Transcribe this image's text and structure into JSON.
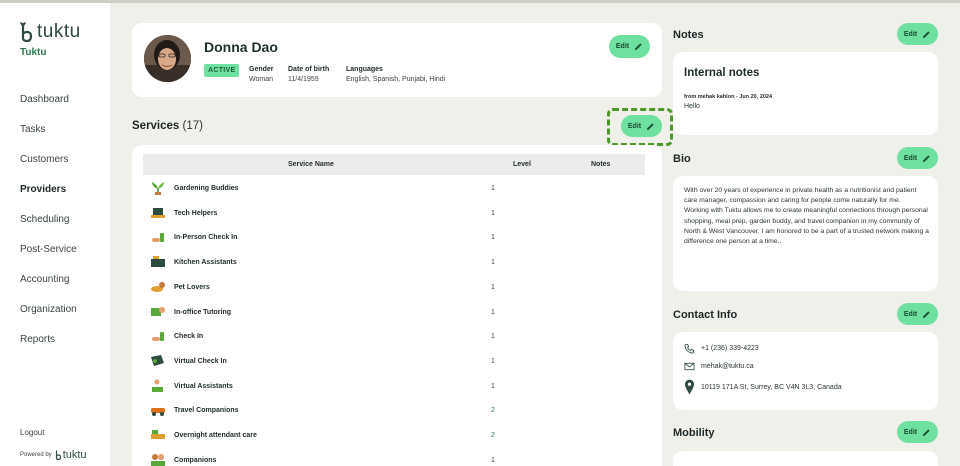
{
  "app": {
    "brand": "tuktu",
    "org_name": "Tuktu",
    "powered_by": "Powered by",
    "powered_brand": "tuktu"
  },
  "sidebar": {
    "items": [
      {
        "label": "Dashboard",
        "active": false
      },
      {
        "label": "Tasks",
        "active": false
      },
      {
        "label": "Customers",
        "active": false
      },
      {
        "label": "Providers",
        "active": true
      },
      {
        "label": "Scheduling",
        "active": false
      },
      {
        "label": "Post-Service",
        "active": false
      },
      {
        "label": "Accounting",
        "active": false
      },
      {
        "label": "Organization",
        "active": false
      },
      {
        "label": "Reports",
        "active": false
      }
    ],
    "logout": "Logout"
  },
  "profile": {
    "name": "Donna Dao",
    "status": "ACTIVE",
    "gender_label": "Gender",
    "gender": "Woman",
    "dob_label": "Date of birth",
    "dob": "11/4/1959",
    "languages_label": "Languages",
    "languages": "English, Spanish, Punjabi, Hindi",
    "edit_label": "Edit"
  },
  "services": {
    "title": "Services",
    "count": "(17)",
    "edit_label": "Edit",
    "columns": [
      "Service Name",
      "Level",
      "Notes"
    ],
    "rows": [
      {
        "name": "Gardening Buddies",
        "level": "1",
        "icon": "plant-icon"
      },
      {
        "name": "Tech Helpers",
        "level": "1",
        "icon": "laptop-icon"
      },
      {
        "name": "In-Person Check In",
        "level": "1",
        "icon": "hand-icon"
      },
      {
        "name": "Kitchen Assistants",
        "level": "1",
        "icon": "stove-icon"
      },
      {
        "name": "Pet Lovers",
        "level": "1",
        "icon": "dog-icon"
      },
      {
        "name": "In-office Tutoring",
        "level": "1",
        "icon": "tutoring-icon"
      },
      {
        "name": "Check In",
        "level": "1",
        "icon": "hand-icon"
      },
      {
        "name": "Virtual Check In",
        "level": "1",
        "icon": "tablet-icon"
      },
      {
        "name": "Virtual Assistants",
        "level": "1",
        "icon": "person-laptop-icon"
      },
      {
        "name": "Travel Companions",
        "level": "2",
        "icon": "car-icon"
      },
      {
        "name": "Overnight attendant care",
        "level": "2",
        "icon": "bed-icon"
      },
      {
        "name": "Companions",
        "level": "1",
        "icon": "people-icon"
      }
    ]
  },
  "notes": {
    "title": "Notes",
    "edit_label": "Edit",
    "heading": "Internal notes",
    "meta": "from mehak kahlon - Jun 20, 2024",
    "text": "Hello"
  },
  "bio": {
    "title": "Bio",
    "edit_label": "Edit",
    "text": "With over 20 years of experience in private health as a nutritionist and patient care manager, compassion and caring for people come naturally for me.\nWorking with Tuktu allows me to create meaningful connections through personal shopping, meal prep, garden buddy, and travel companion in my community of North & West Vancouver. I am honored to be a part of a trusted network making a difference one person at a time.."
  },
  "contact": {
    "title": "Contact Info",
    "edit_label": "Edit",
    "phone": "+1 (236) 339-4223",
    "email": "mehak@tuktu.ca",
    "address": "10119 171A St, Surrey, BC V4N 3L3, Canada"
  },
  "mobility": {
    "title": "Mobility",
    "edit_label": "Edit"
  },
  "colors": {
    "accent": "#6ee0a0",
    "brand": "#2d4a3e",
    "highlight_dash": "#4a9a2a",
    "background": "#f0f0ea"
  }
}
